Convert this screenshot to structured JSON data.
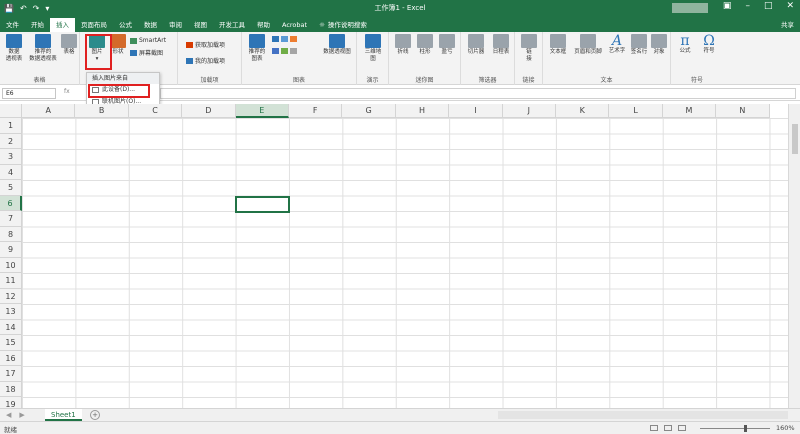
{
  "titlebar": {
    "title": "工作簿1 - Excel",
    "qat_icons": [
      "save-icon",
      "undo-icon",
      "redo-icon",
      "customize-icon"
    ]
  },
  "tabs": [
    "文件",
    "开始",
    "插入",
    "页面布局",
    "公式",
    "数据",
    "审阅",
    "视图",
    "开发工具",
    "帮助",
    "Acrobat"
  ],
  "active_tab": "插入",
  "tell_me": "操作说明搜索",
  "share_label": "共享",
  "ribbon": {
    "tables_group": {
      "label": "表格",
      "pivot": "数据\n透视表",
      "recommended_pivot": "推荐的\n数据透视表",
      "table": "表格"
    },
    "illustrations": {
      "picture": "图片",
      "shapes": "形状",
      "smartart": "SmartArt",
      "screenshot": "屏幕截图"
    },
    "addins": {
      "label": "加载项",
      "get": "获取加载项",
      "mine": "我的加载项"
    },
    "charts": {
      "label": "图表",
      "recommended": "推荐的\n图表",
      "pivotchart": "数据透视图"
    },
    "tours": {
      "label": "演示",
      "map3d": "三维地\n图"
    },
    "sparklines": {
      "label": "迷你图",
      "line": "折线",
      "column": "柱形",
      "winloss": "盈亏"
    },
    "filters": {
      "label": "筛选器",
      "slicer": "切片器",
      "timeline": "日程表"
    },
    "links": {
      "label": "链接",
      "link": "链\n接"
    },
    "text": {
      "label": "文本",
      "textbox": "文本框",
      "header": "页眉和页脚",
      "wordart": "艺术字",
      "signature": "签名行",
      "object": "对象"
    },
    "symbols": {
      "label": "符号",
      "equation": "公式",
      "symbol": "符号",
      "pi": "π",
      "omega": "Ω"
    }
  },
  "dropdown": {
    "header": "插入图片来自",
    "items": [
      "此设备(D)...",
      "联机图片(O)..."
    ]
  },
  "formula_bar": {
    "name_box": "E6",
    "fx": "fx"
  },
  "columns": [
    "A",
    "B",
    "C",
    "D",
    "E",
    "F",
    "G",
    "H",
    "I",
    "J",
    "K",
    "L",
    "M",
    "N"
  ],
  "rows": [
    "1",
    "2",
    "3",
    "4",
    "5",
    "6",
    "7",
    "8",
    "9",
    "10",
    "11",
    "12",
    "13",
    "14",
    "15",
    "16",
    "17",
    "18",
    "19"
  ],
  "active_cell": "E6",
  "sheet_tab": "Sheet1",
  "status": {
    "ready": "就绪",
    "zoom": "160%"
  },
  "colors": {
    "brand": "#217346",
    "highlight": "#e02020"
  }
}
